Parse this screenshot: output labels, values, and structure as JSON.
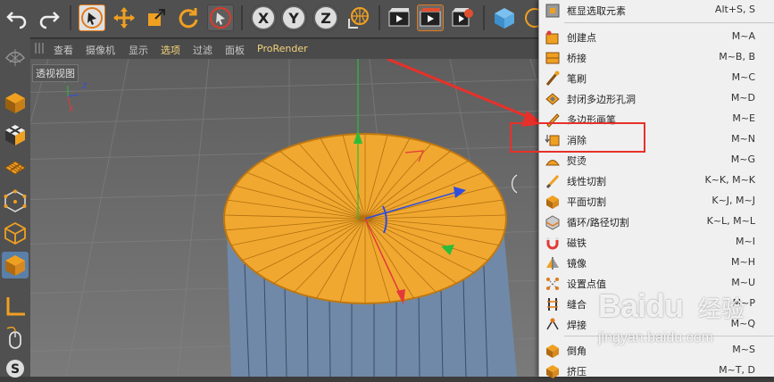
{
  "viewport": {
    "menu": [
      "查看",
      "摄像机",
      "显示",
      "选项",
      "过滤",
      "面板",
      "ProRender"
    ],
    "active_menu": "选项",
    "label": "透视视图"
  },
  "axis_gizmo": {
    "y": "Y",
    "x": "X",
    "z": "Z"
  },
  "context_menu": {
    "items": [
      {
        "label": "框显选取元素",
        "shortcut": "Alt+S, S"
      },
      {
        "label": "创建点",
        "shortcut": "M~A"
      },
      {
        "label": "桥接",
        "shortcut": "M~B, B"
      },
      {
        "label": "笔刷",
        "shortcut": "M~C"
      },
      {
        "label": "封闭多边形孔洞",
        "shortcut": "M~D"
      },
      {
        "label": "多边形画笔",
        "shortcut": "M~E"
      },
      {
        "label": "消除",
        "shortcut": "M~N"
      },
      {
        "label": "熨烫",
        "shortcut": "M~G"
      },
      {
        "label": "线性切割",
        "shortcut": "K~K, M~K"
      },
      {
        "label": "平面切割",
        "shortcut": "K~J, M~J"
      },
      {
        "label": "循环/路径切割",
        "shortcut": "K~L, M~L"
      },
      {
        "label": "磁铁",
        "shortcut": "M~I"
      },
      {
        "label": "镜像",
        "shortcut": "M~H"
      },
      {
        "label": "设置点值",
        "shortcut": "M~U"
      },
      {
        "label": "缝合",
        "shortcut": "M~P"
      },
      {
        "label": "焊接",
        "shortcut": "M~Q"
      },
      {
        "label": "倒角",
        "shortcut": "M~S"
      },
      {
        "label": "挤压",
        "shortcut": "M~T, D"
      }
    ],
    "highlighted": "消除"
  },
  "watermark": {
    "brand": "Baidu",
    "brand2": "经验",
    "url": "jingyan.baidu.com"
  },
  "toolbar": {
    "axis_buttons": [
      "X",
      "Y",
      "Z"
    ]
  },
  "colors": {
    "selection_orange": "#f0a030",
    "highlight_red": "#e8302a"
  }
}
